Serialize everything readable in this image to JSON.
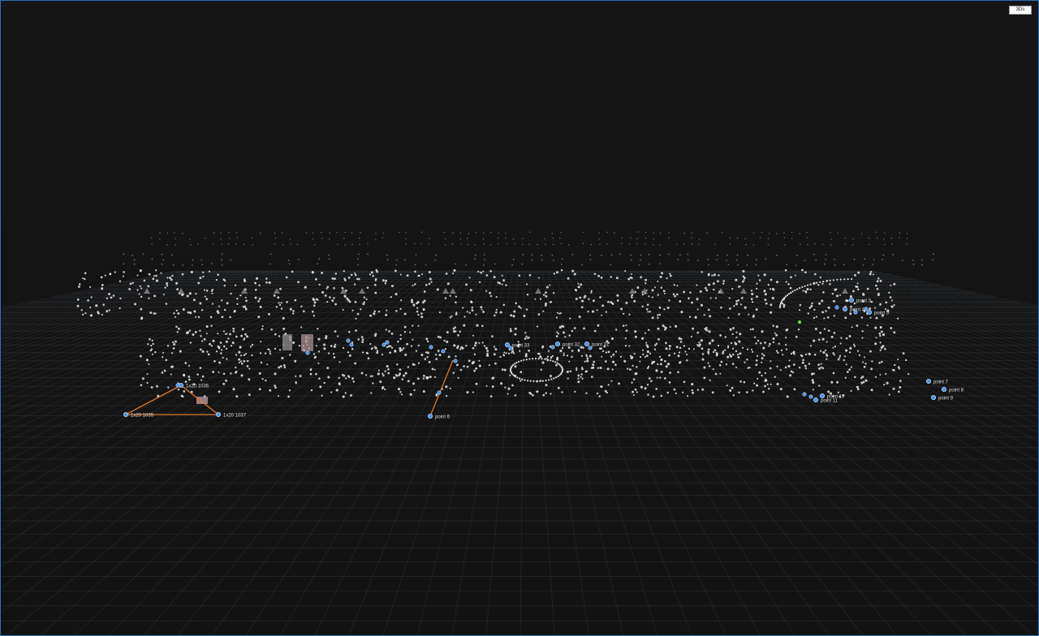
{
  "toolbar": {
    "mode_button_label": "3Ds"
  },
  "colors": {
    "background": "#141414",
    "grid": "#3a4048",
    "points": "#e8e8e8",
    "marker_fill": "#4a90e2",
    "marker_stroke": "#bcd8ff",
    "measure_line": "#e0782a",
    "selection_accent": "#6ad04a"
  },
  "markers": [
    {
      "label": "point 3"
    },
    {
      "label": "point 4"
    },
    {
      "label": "point 5"
    },
    {
      "label": "point 7"
    },
    {
      "label": "point 8"
    },
    {
      "label": "point 9"
    },
    {
      "label": "point 10"
    },
    {
      "label": "point 11"
    },
    {
      "label": "point 6"
    },
    {
      "label": "point 31"
    },
    {
      "label": "point 32"
    },
    {
      "label": "point 33"
    },
    {
      "label": "1x20 1035"
    },
    {
      "label": "1x20 1037"
    },
    {
      "label": "1x20 1036"
    }
  ]
}
